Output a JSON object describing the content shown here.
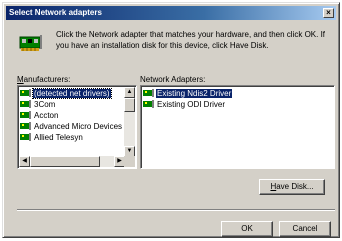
{
  "window": {
    "title": "Select Network adapters",
    "close_glyph": "×"
  },
  "intro_text": "Click the Network adapter that matches your hardware, and then click OK. If you have an installation disk for this device, click Have Disk.",
  "manufacturers": {
    "label_u": "M",
    "label_rest": "anufacturers:",
    "items": [
      "(detected net drivers)",
      "3Com",
      "Accton",
      "Advanced Micro Devices",
      "Allied Telesyn"
    ]
  },
  "network_adapters": {
    "label": "Network Adapters:",
    "items": [
      "Existing Ndis2 Driver",
      "Existing ODI Driver"
    ]
  },
  "buttons": {
    "have_disk_u": "H",
    "have_disk_rest": "ave Disk...",
    "ok": "OK",
    "cancel": "Cancel"
  },
  "icons": {
    "hardware": "network-card-icon",
    "list_item": "adapter-icon"
  },
  "colors": {
    "titlebar_start": "#0a246a",
    "selection": "#0a246a",
    "dialog_face": "#d4d0c8"
  }
}
